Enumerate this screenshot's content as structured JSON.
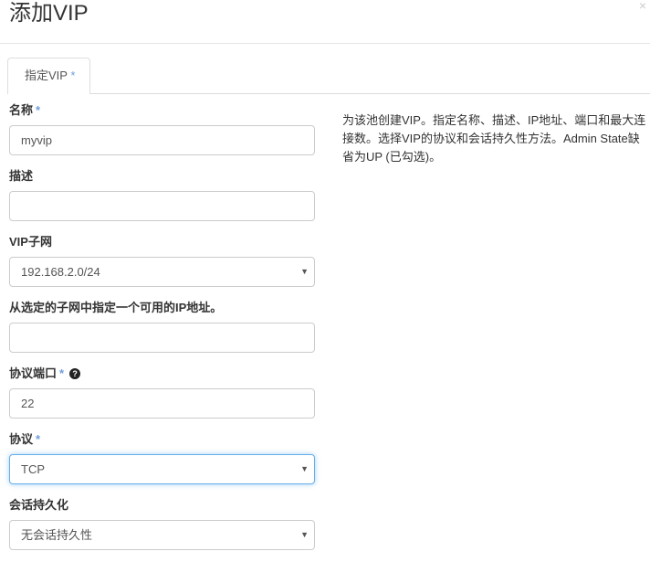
{
  "modal": {
    "title": "添加VIP",
    "close": "×"
  },
  "tab": {
    "label": "指定VIP",
    "required": "*"
  },
  "fields": [
    {
      "label": "名称",
      "required": "*",
      "value": "myvip",
      "type": "input"
    },
    {
      "label": "描述",
      "required": "",
      "value": "",
      "type": "input"
    },
    {
      "label": "VIP子网",
      "required": "",
      "value": "192.168.2.0/24",
      "type": "select"
    },
    {
      "label": "从选定的子网中指定一个可用的IP地址。",
      "required": "",
      "value": "",
      "type": "input"
    },
    {
      "label": "协议端口",
      "required": "*",
      "value": "22",
      "type": "input",
      "help_icon": "question-circle-icon"
    },
    {
      "label": "协议",
      "required": "*",
      "value": "TCP",
      "type": "select",
      "focused": true
    },
    {
      "label": "会话持久化",
      "required": "",
      "value": "无会话持久性",
      "type": "select"
    }
  ],
  "description": "为该池创建VIP。指定名称、描述、IP地址、端口和最大连接数。选择VIP的协议和会话持久性方法。Admin State缺省为UP (已勾选)。",
  "colors": {
    "focus_border": "#66afe9",
    "required": "#6f9fd8"
  }
}
